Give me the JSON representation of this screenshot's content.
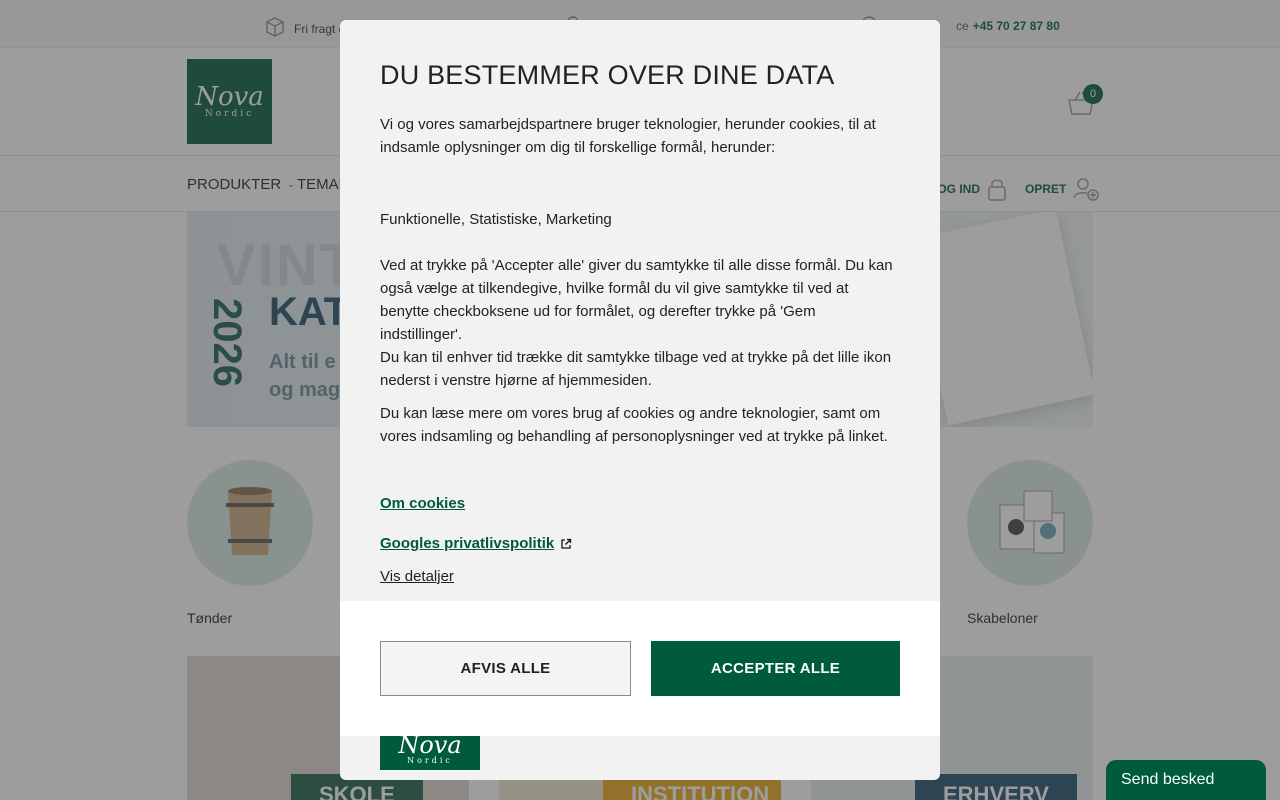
{
  "topbar": {
    "usp1": "Fri fragt o",
    "phone": "+45 70 27 87 80",
    "service_prefix": "ce"
  },
  "header": {
    "logo_line1": "Nova",
    "logo_line2": "Nordic",
    "cart_count": "0"
  },
  "nav": {
    "products": "PRODUKTER",
    "themes": "TEMAE",
    "login": "LOG IND",
    "create": "OPRET"
  },
  "banner": {
    "title_fragment": "VINT",
    "year": "2026",
    "kat_fragment": "KAT",
    "sub_line1": "Alt til e",
    "sub_line2": "og mag"
  },
  "categories": [
    {
      "label": "Tønder"
    },
    {
      "label": "Skabeloner"
    }
  ],
  "tiles": [
    {
      "tag": "SKOLE"
    },
    {
      "tag": "INSTITUTION"
    },
    {
      "tag": "ERHVERV"
    }
  ],
  "chat": {
    "label": "Send besked"
  },
  "consent": {
    "title": "DU BESTEMMER OVER DINE DATA",
    "intro": "Vi og vores samarbejdspartnere bruger teknologier, herunder cookies, til at indsamle oplysninger om dig til forskellige formål, herunder:",
    "purposes": "Funktionelle, Statistiske, Marketing",
    "accept_info_1": "Ved at trykke på 'Accepter alle' giver du samtykke til alle disse formål. Du kan også vælge at tilkendegive, hvilke formål du vil give samtykke til ved at benytte checkboksene ud for formålet, og derefter trykke på 'Gem indstillinger'.",
    "accept_info_2": "Du kan til enhver tid trække dit samtykke tilbage ved at trykke på det lille ikon nederst i venstre hjørne af hjemmesiden.",
    "more_info": "Du kan læse mere om vores brug af cookies og andre teknologier, samt om vores indsamling og behandling af personoplysninger ved at trykke på linket.",
    "link_cookies": "Om cookies",
    "link_google": "Googles privatlivspolitik",
    "details": "Vis detaljer",
    "reject_label": "AFVIS ALLE",
    "accept_label": "ACCEPTER ALLE",
    "logo_line1": "Nova",
    "logo_line2": "Nordic"
  },
  "colors": {
    "brand_green": "#005a3c",
    "overlay": "rgba(60,60,60,0.5)"
  }
}
